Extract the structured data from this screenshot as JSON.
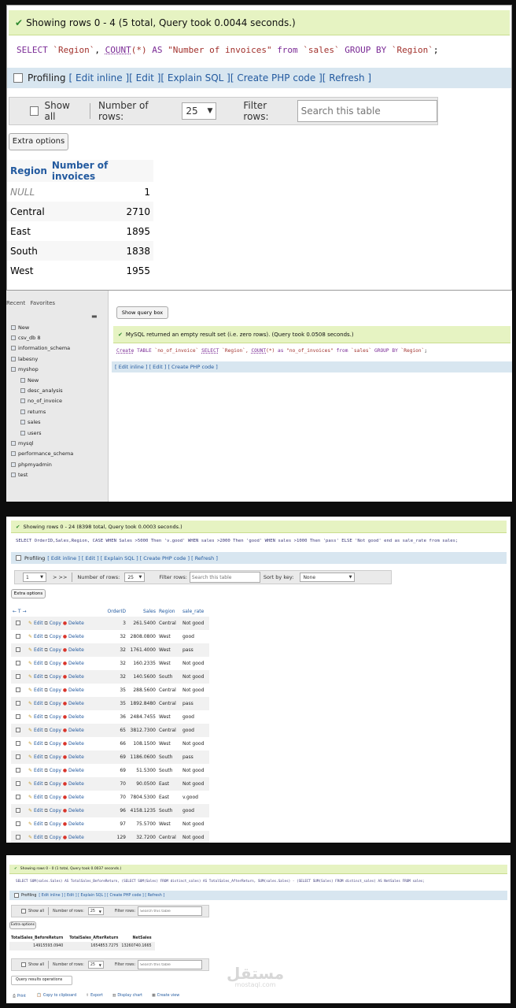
{
  "p1": {
    "status": "Showing rows 0 - 4 (5 total, Query took 0.0044 seconds.)",
    "sql": {
      "t1": "SELECT",
      "t2": "`Region`",
      "t3": ",",
      "t4": "COUNT",
      "t5": "(*)",
      "t6": "AS",
      "t7": "\"Number of invoices\"",
      "t8": "from",
      "t9": "`sales`",
      "t10": "GROUP BY",
      "t11": "`Region`",
      "t12": ";"
    },
    "profiling": "Profiling",
    "links": {
      "edit_inline": "[ Edit inline ]",
      "edit": "[ Edit ]",
      "explain": "[ Explain SQL ]",
      "php": "[ Create PHP code ]",
      "refresh": "[ Refresh ]"
    },
    "show_all": "Show all",
    "num_rows_label": "Number of rows:",
    "num_rows_value": "25",
    "filter_label": "Filter rows:",
    "filter_placeholder": "Search this table",
    "extra_options": "Extra options",
    "columns": [
      "Region",
      "Number of invoices"
    ],
    "rows": [
      {
        "region": "NULL",
        "count": "1"
      },
      {
        "region": "Central",
        "count": "2710"
      },
      {
        "region": "East",
        "count": "1895"
      },
      {
        "region": "South",
        "count": "1838"
      },
      {
        "region": "West",
        "count": "1955"
      }
    ]
  },
  "p2": {
    "tabs": {
      "recent": "Recent",
      "favorites": "Favorites"
    },
    "tree": [
      {
        "label": "New",
        "level": 0
      },
      {
        "label": "csv_db 8",
        "level": 0
      },
      {
        "label": "information_schema",
        "level": 0
      },
      {
        "label": "labesny",
        "level": 0
      },
      {
        "label": "myshop",
        "level": 0
      },
      {
        "label": "New",
        "level": 1
      },
      {
        "label": "desc_analysis",
        "level": 1
      },
      {
        "label": "no_of_invoice",
        "level": 1
      },
      {
        "label": "returns",
        "level": 1
      },
      {
        "label": "sales",
        "level": 1
      },
      {
        "label": "users",
        "level": 1
      },
      {
        "label": "mysql",
        "level": 0
      },
      {
        "label": "performance_schema",
        "level": 0
      },
      {
        "label": "phpmyadmin",
        "level": 0
      },
      {
        "label": "test",
        "level": 0
      }
    ],
    "show_query_box": "Show query box",
    "status": "MySQL returned an empty result set (i.e. zero rows). (Query took 0.0508 seconds.)",
    "sql": {
      "t1": "Create",
      "t2": "TABLE",
      "t3": "`no_of_invoice`",
      "t4": "SELECT",
      "t5": "`Region`,",
      "t6": "COUNT",
      "t7": "(*)",
      "t8": "as",
      "t9": "\"no_of_invoices\"",
      "t10": "from",
      "t11": "`sales`",
      "t12": "GROUP BY",
      "t13": "`Region`",
      "t14": ";"
    },
    "links": "[ Edit inline ] [ Edit ] [ Create PHP code ]"
  },
  "p3": {
    "status": "Showing rows 0 - 24 (8398 total, Query took 0.0003 seconds.)",
    "sql": "SELECT OrderID,Sales,Region, CASE WHEN Sales >5000 Then 'v.good' WHEN sales >2000 Then 'good' WHEN sales >1000 Then 'pass' ELSE 'Not good' end as sale_rate from sales;",
    "profiling": "Profiling",
    "links": "[ Edit inline ] [ Edit ] [ Explain SQL ] [ Create PHP code ] [ Refresh ]",
    "page": "1",
    "nav_next": "> >>",
    "num_rows_label": "Number of rows:",
    "num_rows_value": "25",
    "filter_label": "Filter rows:",
    "filter_placeholder": "Search this table",
    "sort_label": "Sort by key:",
    "sort_value": "None",
    "extra_options": "Extra options",
    "col_tools": "← T →",
    "columns": [
      "OrderID",
      "Sales",
      "Region",
      "sale_rate"
    ],
    "action_edit": "Edit",
    "action_copy": "Copy",
    "action_delete": "Delete",
    "rows": [
      {
        "id": "3",
        "sales": "261.5400",
        "region": "Central",
        "rate": "Not good"
      },
      {
        "id": "32",
        "sales": "2808.0800",
        "region": "West",
        "rate": "good"
      },
      {
        "id": "32",
        "sales": "1761.4000",
        "region": "West",
        "rate": "pass"
      },
      {
        "id": "32",
        "sales": "160.2335",
        "region": "West",
        "rate": "Not good"
      },
      {
        "id": "32",
        "sales": "140.5600",
        "region": "South",
        "rate": "Not good"
      },
      {
        "id": "35",
        "sales": "288.5600",
        "region": "Central",
        "rate": "Not good"
      },
      {
        "id": "35",
        "sales": "1892.8480",
        "region": "Central",
        "rate": "pass"
      },
      {
        "id": "36",
        "sales": "2484.7455",
        "region": "West",
        "rate": "good"
      },
      {
        "id": "65",
        "sales": "3812.7300",
        "region": "Central",
        "rate": "good"
      },
      {
        "id": "66",
        "sales": "108.1500",
        "region": "West",
        "rate": "Not good"
      },
      {
        "id": "69",
        "sales": "1186.0600",
        "region": "South",
        "rate": "pass"
      },
      {
        "id": "69",
        "sales": "51.5300",
        "region": "South",
        "rate": "Not good"
      },
      {
        "id": "70",
        "sales": "90.0500",
        "region": "East",
        "rate": "Not good"
      },
      {
        "id": "70",
        "sales": "7804.5300",
        "region": "East",
        "rate": "v.good"
      },
      {
        "id": "96",
        "sales": "4158.1235",
        "region": "South",
        "rate": "good"
      },
      {
        "id": "97",
        "sales": "75.5700",
        "region": "West",
        "rate": "Not good"
      },
      {
        "id": "129",
        "sales": "32.7200",
        "region": "Central",
        "rate": "Not good"
      }
    ]
  },
  "p4": {
    "status": "Showing rows 0 - 0 (1 total, Query took 0.0037 seconds.)",
    "sql": "SELECT SUM(sales.Sales) AS TotalSales_BeforeReturn, (SELECT SUM(Sales) FROM distinct_sales) AS TotalSales_AfterReturn, SUM(sales.Sales) - (SELECT SUM(Sales) FROM distinct_sales) AS NetSales FROM sales;",
    "profiling": "Profiling",
    "links": "[ Edit inline ] [ Edit ] [ Explain SQL ] [ Create PHP code ] [ Refresh ]",
    "show_all": "Show all",
    "num_rows_label": "Number of rows:",
    "num_rows_value": "25",
    "filter_label": "Filter rows:",
    "filter_placeholder": "Search this table",
    "extra_options": "Extra options",
    "columns": [
      "TotalSales_BeforeReturn",
      "TotalSales_AfterReturn",
      "NetSales"
    ],
    "row": [
      "14915593.0940",
      "1654853.7275",
      "13260740.1665"
    ],
    "query_ops": "Query results operations",
    "ops": [
      {
        "icon": "print-icon",
        "label": "Print"
      },
      {
        "icon": "clipboard-icon",
        "label": "Copy to clipboard"
      },
      {
        "icon": "export-icon",
        "label": "Export"
      },
      {
        "icon": "chart-icon",
        "label": "Display chart"
      },
      {
        "icon": "view-icon",
        "label": "Create view"
      }
    ],
    "watermark": "مستقل",
    "watermark_url": "mostaql.com"
  }
}
